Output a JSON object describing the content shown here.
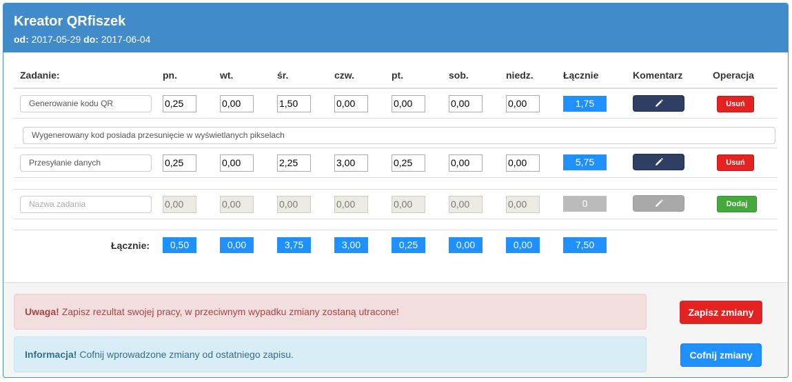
{
  "header": {
    "title": "Kreator QRfiszek",
    "from_label": "od:",
    "from_value": "2017-05-29",
    "to_label": "do:",
    "to_value": "2017-06-04"
  },
  "table": {
    "columns": [
      "Zadanie:",
      "pn.",
      "wt.",
      "śr.",
      "czw.",
      "pt.",
      "sob.",
      "niedz.",
      "Łącznie",
      "Komentarz",
      "Operacja"
    ],
    "rows": [
      {
        "name": "Generowanie kodu QR",
        "days": [
          "0,25",
          "0,00",
          "1,50",
          "0,00",
          "0,00",
          "0,00",
          "0,00"
        ],
        "total": "1,75",
        "operation": "Usuń",
        "comment": "Wygenerowany kod posiada przesunięcie w wyświetlanych pikselach"
      },
      {
        "name": "Przesyłanie danych",
        "days": [
          "0,25",
          "0,00",
          "2,25",
          "3,00",
          "0,25",
          "0,00",
          "0,00"
        ],
        "total": "5,75",
        "operation": "Usuń"
      }
    ],
    "new_row": {
      "name_placeholder": "Nazwa zadania",
      "days_placeholder": [
        "0,00",
        "0,00",
        "0,00",
        "0,00",
        "0,00",
        "0,00",
        "0,00"
      ],
      "total": "0",
      "operation": "Dodaj"
    },
    "sums": {
      "label": "Łącznie:",
      "days": [
        "0,50",
        "0,00",
        "3,75",
        "3,00",
        "0,25",
        "0,00",
        "0,00"
      ],
      "total": "7,50"
    }
  },
  "footer": {
    "warning_title": "Uwaga!",
    "warning_text": "Zapisz rezultat swojej pracy, w przeciwnym wypadku zmiany zostaną utracone!",
    "info_title": "Informacja!",
    "info_text": "Cofnij wprowadzone zmiany od ostatniego zapisu.",
    "save_label": "Zapisz zmiany",
    "undo_label": "Cofnij zmiany"
  },
  "colors": {
    "header_bg": "#428bca",
    "accent_blue": "#1e90ff",
    "danger": "#e32222",
    "success": "#43a93a",
    "edit_button": "#2e3f63"
  },
  "icons": {
    "edit": "pencil-icon"
  }
}
